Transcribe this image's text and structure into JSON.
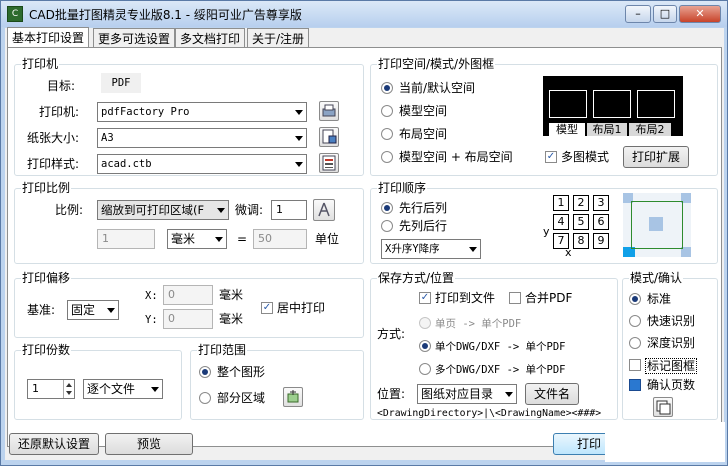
{
  "window": {
    "title": "CAD批量打图精灵专业版8.1 - 绥阳可业广告尊享版",
    "icon_label": "C"
  },
  "tabs": [
    {
      "label": "基本打印设置"
    },
    {
      "label": "更多可选设置"
    },
    {
      "label": "多文档打印"
    },
    {
      "label": "关于/注册"
    }
  ],
  "printer_group": {
    "title": "打印机",
    "target_label": "目标:",
    "target_value": "PDF",
    "printer_label": "打印机:",
    "printer_value": "pdfFactory Pro",
    "paper_label": "纸张大小:",
    "paper_value": "A3",
    "style_label": "打印样式:",
    "style_value": "acad.ctb"
  },
  "scale_group": {
    "title": "打印比例",
    "ratio_label": "比例:",
    "ratio_value": "缩放到可打印区域(F",
    "fine_label": "微调:",
    "fine_value": "1",
    "left_value": "1",
    "unit_value": "毫米",
    "equals": "=",
    "right_value": "50",
    "unit_label": "单位"
  },
  "offset_group": {
    "title": "打印偏移",
    "base_label": "基准:",
    "base_value": "固定",
    "x_label": "X:",
    "x_value": "0",
    "x_unit": "毫米",
    "y_label": "Y:",
    "y_value": "0",
    "y_unit": "毫米",
    "center_label": "居中打印"
  },
  "copies_group": {
    "title": "打印份数",
    "count": "1",
    "mode": "逐个文件"
  },
  "range_group": {
    "title": "打印范围",
    "whole": "整个图形",
    "partial": "部分区域"
  },
  "space_group": {
    "title": "打印空间/模式/外图框",
    "options": [
      "当前/默认空间",
      "模型空间",
      "布局空间",
      "模型空间 + 布局空间"
    ],
    "multi_frame": "多图模式",
    "expand_button": "打印扩展",
    "preview_tabs": [
      "模型",
      "布局1",
      "布局2"
    ]
  },
  "order_group": {
    "title": "打印顺序",
    "opt1": "先行后列",
    "opt2": "先列后行",
    "sort_value": "X升序Y降序",
    "grid": [
      "1",
      "2",
      "3",
      "4",
      "5",
      "6",
      "7",
      "8",
      "9"
    ],
    "axis_y": "y",
    "axis_x": "x"
  },
  "save_group": {
    "title": "保存方式/位置",
    "to_file": "打印到文件",
    "merge_pdf": "合并PDF",
    "method_label": "方式:",
    "m1": "单页 -> 单个PDF",
    "m2": "单个DWG/DXF -> 单个PDF",
    "m3": "多个DWG/DXF -> 单个PDF",
    "location_label": "位置:",
    "location_value": "图纸对应目录",
    "filename_button": "文件名",
    "path_pattern": "<DrawingDirectory>|\\<DrawingName><###>"
  },
  "confirm_group": {
    "title": "模式/确认",
    "opt1": "标准",
    "opt2": "快速识别",
    "opt3": "深度识别",
    "mark_frame": "标记图框",
    "confirm_pages": "确认页数"
  },
  "bottom": {
    "reset": "还原默认设置",
    "preview": "预览",
    "print": "打印"
  }
}
